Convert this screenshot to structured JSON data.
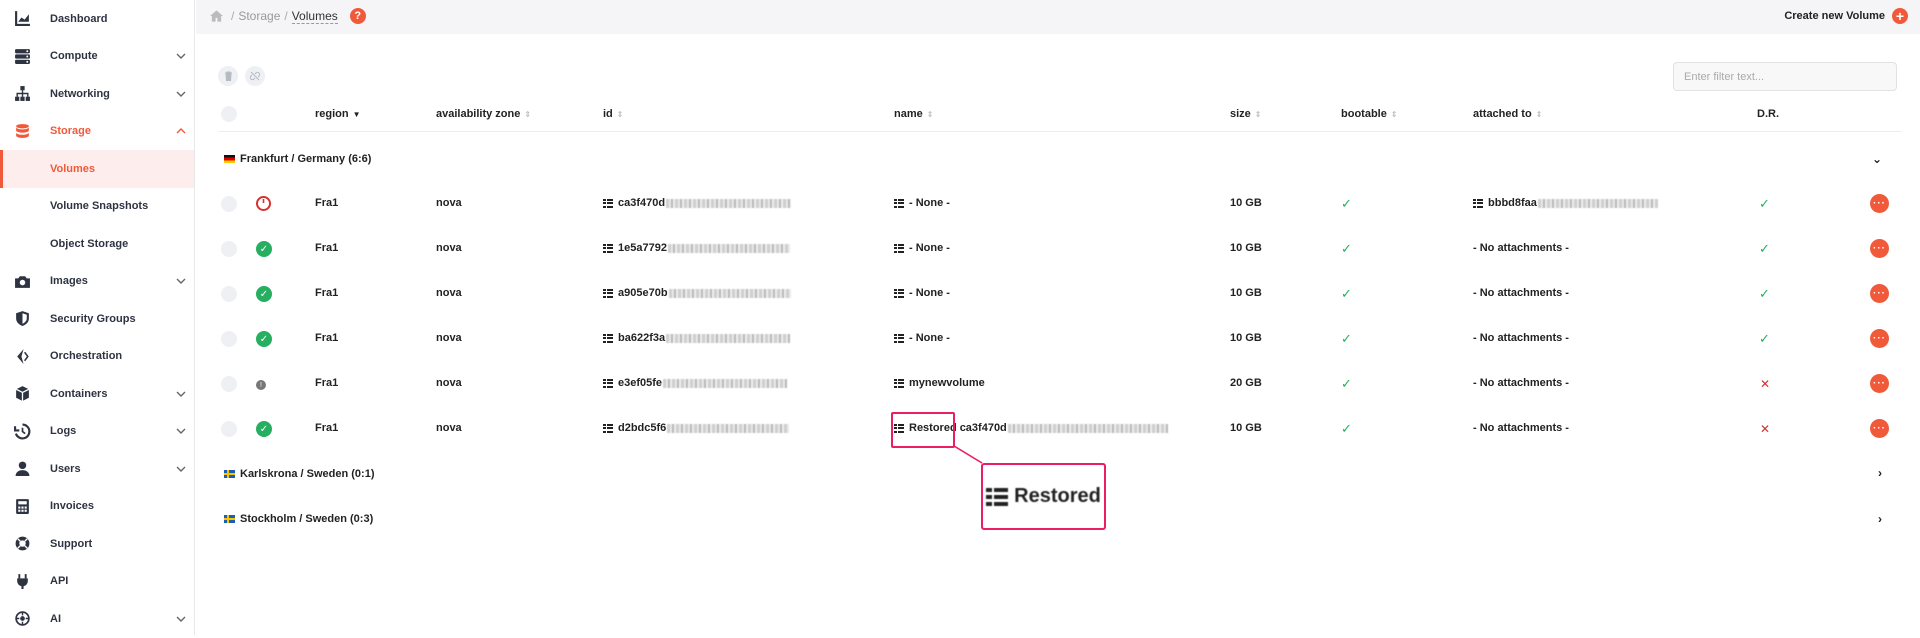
{
  "sidebar": {
    "items": [
      {
        "label": "Dashboard",
        "icon": "chart-icon"
      },
      {
        "label": "Compute",
        "icon": "server-icon"
      },
      {
        "label": "Networking",
        "icon": "network-icon"
      },
      {
        "label": "Storage",
        "icon": "database-icon"
      },
      {
        "label": "Images",
        "icon": "camera-icon"
      },
      {
        "label": "Security Groups",
        "icon": "shield-icon"
      },
      {
        "label": "Orchestration",
        "icon": "orchestration-icon"
      },
      {
        "label": "Containers",
        "icon": "cube-icon"
      },
      {
        "label": "Logs",
        "icon": "history-icon"
      },
      {
        "label": "Users",
        "icon": "user-icon"
      },
      {
        "label": "Invoices",
        "icon": "calculator-icon"
      },
      {
        "label": "Support",
        "icon": "lifebuoy-icon"
      },
      {
        "label": "API",
        "icon": "plug-icon"
      },
      {
        "label": "AI",
        "icon": "ai-icon"
      }
    ],
    "storage_sub": [
      "Volumes",
      "Volume Snapshots",
      "Object Storage"
    ]
  },
  "breadcrumb": {
    "storage": "Storage",
    "current": "Volumes",
    "help": "?"
  },
  "header": {
    "create_label": "Create new Volume"
  },
  "filter": {
    "placeholder": "Enter filter text..."
  },
  "columns": {
    "region": "region",
    "availability_zone": "availability zone",
    "id": "id",
    "name": "name",
    "size": "size",
    "bootable": "bootable",
    "attached_to": "attached to",
    "dr": "D.R."
  },
  "groups": [
    {
      "label": "Frankfurt / Germany (6:6)",
      "flag": "de",
      "expanded": true
    },
    {
      "label": "Karlskrona / Sweden (0:1)",
      "flag": "se",
      "expanded": false
    },
    {
      "label": "Stockholm / Sweden (0:3)",
      "flag": "se",
      "expanded": false
    }
  ],
  "rows": [
    {
      "status": "power",
      "region": "Fra1",
      "az": "nova",
      "id": "ca3f470d",
      "name": "- None -",
      "size": "10 GB",
      "bootable": true,
      "attached": "bbbd8faa",
      "dr": true
    },
    {
      "status": "ok",
      "region": "Fra1",
      "az": "nova",
      "id": "1e5a7792",
      "name": "- None -",
      "size": "10 GB",
      "bootable": true,
      "attached": "- No attachments -",
      "dr": true
    },
    {
      "status": "ok",
      "region": "Fra1",
      "az": "nova",
      "id": "a905e70b",
      "name": "- None -",
      "size": "10 GB",
      "bootable": true,
      "attached": "- No attachments -",
      "dr": true
    },
    {
      "status": "ok",
      "region": "Fra1",
      "az": "nova",
      "id": "ba622f3a",
      "name": "- None -",
      "size": "10 GB",
      "bootable": true,
      "attached": "- No attachments -",
      "dr": true
    },
    {
      "status": "info",
      "region": "Fra1",
      "az": "nova",
      "id": "e3ef05fe",
      "name": "mynewvolume",
      "size": "20 GB",
      "bootable": true,
      "attached": "- No attachments -",
      "dr": false
    },
    {
      "status": "ok",
      "region": "Fra1",
      "az": "nova",
      "id": "d2bdc5f6",
      "name": "Restored",
      "name_suffix": "ca3f470d",
      "size": "10 GB",
      "bootable": true,
      "attached": "- No attachments -",
      "dr": false
    }
  ],
  "zoom": {
    "label": "Restored"
  },
  "colors": {
    "accent": "#f05a3a",
    "ok": "#27ae60",
    "error": "#d63030",
    "highlight": "#e91e63"
  }
}
